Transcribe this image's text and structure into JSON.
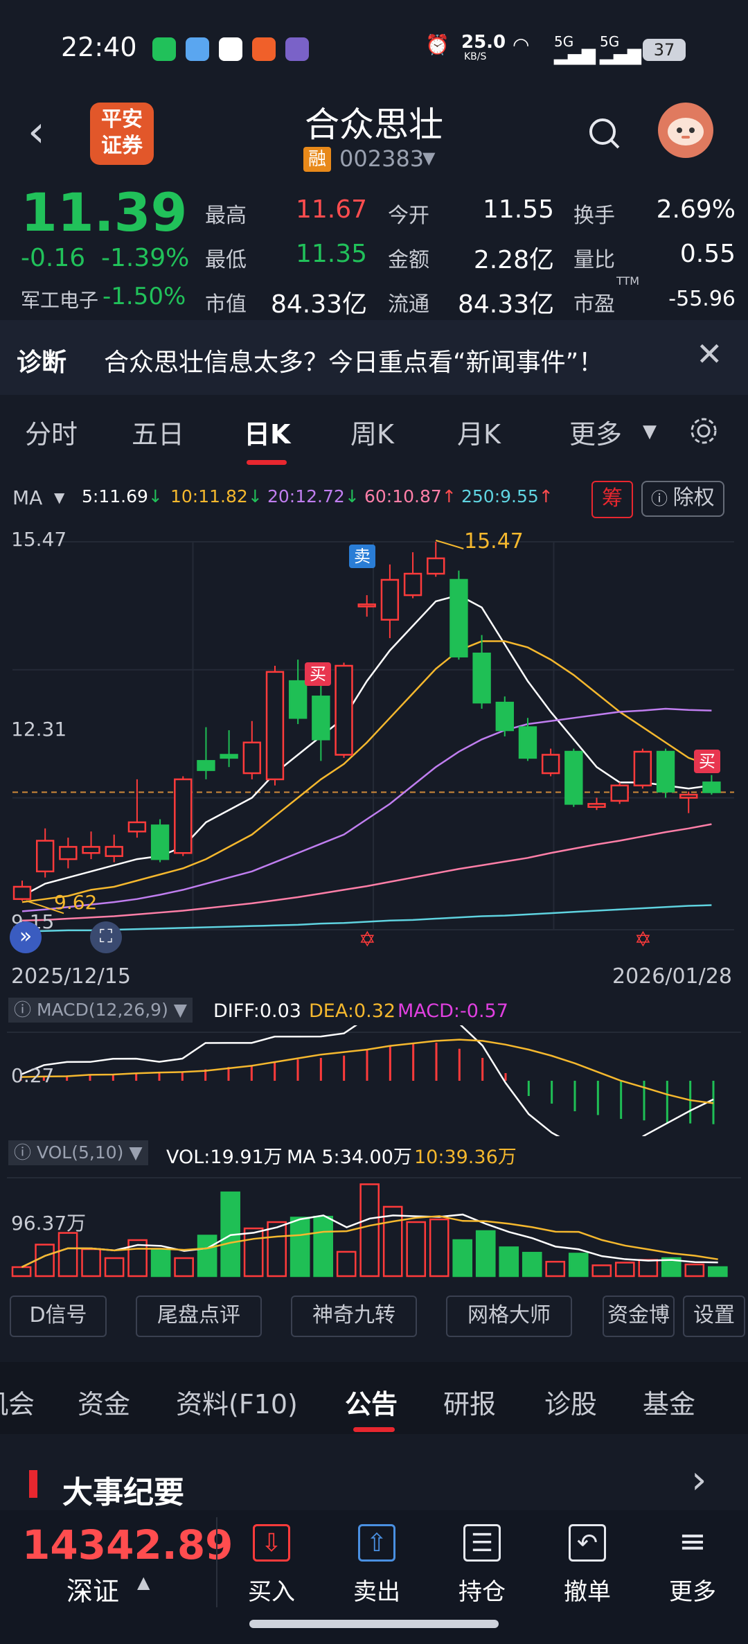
{
  "status_bar": {
    "time": "22:40",
    "net_speed": "25.0",
    "net_unit": "KB/S",
    "sig1": "5G",
    "sig2": "5G",
    "battery": "37"
  },
  "header": {
    "logo_line1": "平安",
    "logo_line2": "证券",
    "title": "合众思壮",
    "rong_badge": "融",
    "code": "002383"
  },
  "quote": {
    "price": "11.39",
    "change": "-0.16",
    "change_pct": "-1.39%",
    "sector": "军工电子",
    "sector_pct": "-1.50%",
    "fields": [
      {
        "label": "最高",
        "value": "11.67",
        "color": "#ff4d4f"
      },
      {
        "label": "今开",
        "value": "11.55",
        "color": "#ffffff"
      },
      {
        "label": "换手",
        "value": "2.69%",
        "color": "#ffffff"
      },
      {
        "label": "最低",
        "value": "11.35",
        "color": "#21c15a"
      },
      {
        "label": "金额",
        "value": "2.28亿",
        "color": "#ffffff"
      },
      {
        "label": "量比",
        "value": "0.55",
        "color": "#ffffff"
      },
      {
        "label": "市值",
        "value": "84.33亿",
        "color": "#ffffff"
      },
      {
        "label": "流通",
        "value": "84.33亿",
        "color": "#ffffff"
      },
      {
        "label": "市盈",
        "value": "-55.96",
        "color": "#ffffff"
      }
    ],
    "ttm": "TTM"
  },
  "diagnosis": {
    "label": "诊断",
    "text": "合众思壮信息太多？今日重点看“新闻事件”！"
  },
  "chart_tabs": [
    "分时",
    "五日",
    "日K",
    "周K",
    "月K",
    "更多"
  ],
  "ma_row": {
    "label": "MA",
    "items": [
      {
        "text": "5:11.69",
        "arrow": "↓",
        "color": "#ffffff",
        "arrow_color": "#21c15a"
      },
      {
        "text": "10:11.82",
        "arrow": "↓",
        "color": "#f5b82e",
        "arrow_color": "#21c15a"
      },
      {
        "text": "20:12.72",
        "arrow": "↓",
        "color": "#c07ef0",
        "arrow_color": "#21c15a"
      },
      {
        "text": "60:10.87",
        "arrow": "↑",
        "color": "#ff7fa8",
        "arrow_color": "#ff4d4f"
      },
      {
        "text": "250:9.55",
        "arrow": "↑",
        "color": "#5fd3e0",
        "arrow_color": "#ff4d4f"
      }
    ],
    "chip": "筹",
    "exright": "除权"
  },
  "kline": {
    "y_top": "15.47",
    "y_mid": "12.31",
    "y_low": "9.15",
    "high_label": "15.47",
    "low_label": "9.62",
    "start_date": "2025/12/15",
    "end_date": "2026/01/28",
    "sell_mark": "卖",
    "buy_mark": "买",
    "buy_mark2": "买"
  },
  "chart_data": {
    "type": "candlestick",
    "y_range": [
      9.15,
      15.47
    ],
    "x_range": [
      "2025/12/15",
      "2026/01/28"
    ],
    "candles": [
      {
        "o": 9.65,
        "c": 9.85,
        "h": 9.95,
        "l": 9.62
      },
      {
        "o": 10.1,
        "c": 10.6,
        "h": 10.8,
        "l": 10.0
      },
      {
        "o": 10.3,
        "c": 10.5,
        "h": 10.65,
        "l": 10.15
      },
      {
        "o": 10.4,
        "c": 10.5,
        "h": 10.75,
        "l": 10.3
      },
      {
        "o": 10.35,
        "c": 10.5,
        "h": 10.7,
        "l": 10.25
      },
      {
        "o": 10.75,
        "c": 10.9,
        "h": 11.6,
        "l": 10.65
      },
      {
        "o": 10.85,
        "c": 10.3,
        "h": 10.95,
        "l": 10.25
      },
      {
        "o": 10.4,
        "c": 11.6,
        "h": 11.65,
        "l": 10.35
      },
      {
        "o": 11.9,
        "c": 11.75,
        "h": 12.45,
        "l": 11.6
      },
      {
        "o": 12.0,
        "c": 11.95,
        "h": 12.4,
        "l": 11.8
      },
      {
        "o": 11.7,
        "c": 12.2,
        "h": 12.55,
        "l": 11.6
      },
      {
        "o": 11.6,
        "c": 13.35,
        "h": 13.45,
        "l": 11.5
      },
      {
        "o": 13.2,
        "c": 12.6,
        "h": 13.55,
        "l": 12.5
      },
      {
        "o": 12.95,
        "c": 12.25,
        "h": 13.15,
        "l": 11.9
      },
      {
        "o": 12.0,
        "c": 13.45,
        "h": 13.5,
        "l": 11.95
      },
      {
        "o": 14.45,
        "c": 14.45,
        "h": 14.6,
        "l": 14.25
      },
      {
        "o": 14.2,
        "c": 14.85,
        "h": 15.1,
        "l": 13.9
      },
      {
        "o": 14.6,
        "c": 14.95,
        "h": 15.3,
        "l": 14.55
      },
      {
        "o": 14.95,
        "c": 15.2,
        "h": 15.47,
        "l": 14.9
      },
      {
        "o": 14.85,
        "c": 13.6,
        "h": 15.0,
        "l": 13.55
      },
      {
        "o": 13.65,
        "c": 12.85,
        "h": 13.95,
        "l": 12.75
      },
      {
        "o": 12.85,
        "c": 12.4,
        "h": 12.95,
        "l": 12.3
      },
      {
        "o": 12.45,
        "c": 11.95,
        "h": 12.6,
        "l": 11.9
      },
      {
        "o": 11.7,
        "c": 12.0,
        "h": 12.1,
        "l": 11.65
      },
      {
        "o": 12.05,
        "c": 11.2,
        "h": 12.1,
        "l": 11.15
      },
      {
        "o": 11.15,
        "c": 11.2,
        "h": 11.3,
        "l": 11.1
      },
      {
        "o": 11.25,
        "c": 11.5,
        "h": 11.55,
        "l": 11.2
      },
      {
        "o": 11.5,
        "c": 12.05,
        "h": 12.1,
        "l": 11.45
      },
      {
        "o": 12.05,
        "c": 11.4,
        "h": 12.1,
        "l": 11.3
      },
      {
        "o": 11.3,
        "c": 11.35,
        "h": 11.4,
        "l": 11.05
      },
      {
        "o": 11.55,
        "c": 11.39,
        "h": 11.67,
        "l": 11.35
      }
    ],
    "ma_lines": [
      {
        "name": "MA5",
        "color": "#ffffff",
        "values": [
          9.7,
          9.9,
          10.0,
          10.1,
          10.2,
          10.3,
          10.35,
          10.5,
          10.9,
          11.1,
          11.3,
          11.7,
          12.0,
          12.3,
          12.6,
          13.2,
          13.7,
          14.1,
          14.5,
          14.6,
          14.4,
          13.8,
          13.2,
          12.7,
          12.25,
          11.8,
          11.55,
          11.55,
          11.5,
          11.45,
          11.5
        ]
      },
      {
        "name": "MA10",
        "color": "#f5b82e",
        "values": [
          9.6,
          9.65,
          9.7,
          9.8,
          9.85,
          9.95,
          10.05,
          10.15,
          10.3,
          10.5,
          10.7,
          11.0,
          11.3,
          11.6,
          11.85,
          12.2,
          12.6,
          13.0,
          13.4,
          13.7,
          13.85,
          13.85,
          13.75,
          13.55,
          13.3,
          13.0,
          12.7,
          12.45,
          12.2,
          11.95,
          11.82
        ]
      },
      {
        "name": "MA20",
        "color": "#c07ef0",
        "values": [
          9.45,
          9.48,
          9.52,
          9.56,
          9.6,
          9.65,
          9.72,
          9.8,
          9.9,
          10.0,
          10.1,
          10.25,
          10.4,
          10.55,
          10.7,
          10.95,
          11.2,
          11.5,
          11.8,
          12.05,
          12.25,
          12.4,
          12.5,
          12.55,
          12.6,
          12.65,
          12.7,
          12.72,
          12.75,
          12.73,
          12.72
        ]
      },
      {
        "name": "MA60",
        "color": "#ff7fa8",
        "values": [
          9.3,
          9.31,
          9.33,
          9.35,
          9.37,
          9.4,
          9.43,
          9.46,
          9.5,
          9.54,
          9.58,
          9.63,
          9.68,
          9.74,
          9.8,
          9.86,
          9.93,
          10.0,
          10.07,
          10.14,
          10.2,
          10.26,
          10.32,
          10.4,
          10.47,
          10.54,
          10.6,
          10.67,
          10.74,
          10.8,
          10.87
        ]
      },
      {
        "name": "MA250",
        "color": "#5fd3e0",
        "values": [
          9.12,
          9.13,
          9.14,
          9.14,
          9.15,
          9.16,
          9.17,
          9.18,
          9.19,
          9.2,
          9.21,
          9.22,
          9.23,
          9.25,
          9.26,
          9.28,
          9.3,
          9.31,
          9.33,
          9.35,
          9.37,
          9.38,
          9.4,
          9.42,
          9.44,
          9.46,
          9.48,
          9.5,
          9.52,
          9.54,
          9.55
        ]
      }
    ],
    "macd_hist": [
      0.05,
      0.06,
      0.07,
      0.08,
      0.08,
      0.09,
      0.1,
      0.12,
      0.15,
      0.18,
      0.2,
      0.25,
      0.28,
      0.3,
      0.33,
      0.4,
      0.45,
      0.5,
      0.5,
      0.42,
      0.3,
      0.1,
      -0.2,
      -0.3,
      -0.4,
      -0.45,
      -0.5,
      -0.52,
      -0.55,
      -0.56,
      -0.57
    ],
    "volume": [
      1.0,
      3.5,
      4.8,
      3.0,
      2.0,
      4.0,
      3.0,
      2.0,
      4.5,
      9.3,
      5.3,
      6.0,
      6.5,
      6.6,
      2.7,
      10.2,
      7.7,
      6.0,
      6.3,
      4.0,
      5.0,
      3.2,
      2.6,
      1.6,
      2.5,
      1.2,
      1.5,
      1.8,
      2.0,
      1.3,
      1.0
    ]
  },
  "macd": {
    "label": "MACD(12,26,9)",
    "diff": "DIFF:0.03",
    "dea": "DEA:0.32",
    "macd": "MACD:-0.57",
    "axis": "0.27"
  },
  "vol": {
    "label": "VOL(5,10)",
    "vol": "VOL:19.91万",
    "ma5": "MA 5:34.00万",
    "ma10": "10:39.36万",
    "axis": "96.37万"
  },
  "signal_buttons": [
    "D信号",
    "尾盘点评",
    "神奇九转",
    "网格大师",
    "资金博",
    "设置"
  ],
  "bottom_tabs": [
    "机会",
    "资金",
    "资料(F10)",
    "公告",
    "研报",
    "诊股",
    "基金"
  ],
  "events": {
    "title": "大事纪要"
  },
  "index": {
    "value": "14342.89",
    "name": "深证"
  },
  "toolbar": [
    "买入",
    "卖出",
    "持仓",
    "撤单",
    "更多"
  ],
  "colors": {
    "up": "#ff4d4f",
    "down": "#21c15a",
    "accent": "#e8272f",
    "bg": "#161b26"
  }
}
